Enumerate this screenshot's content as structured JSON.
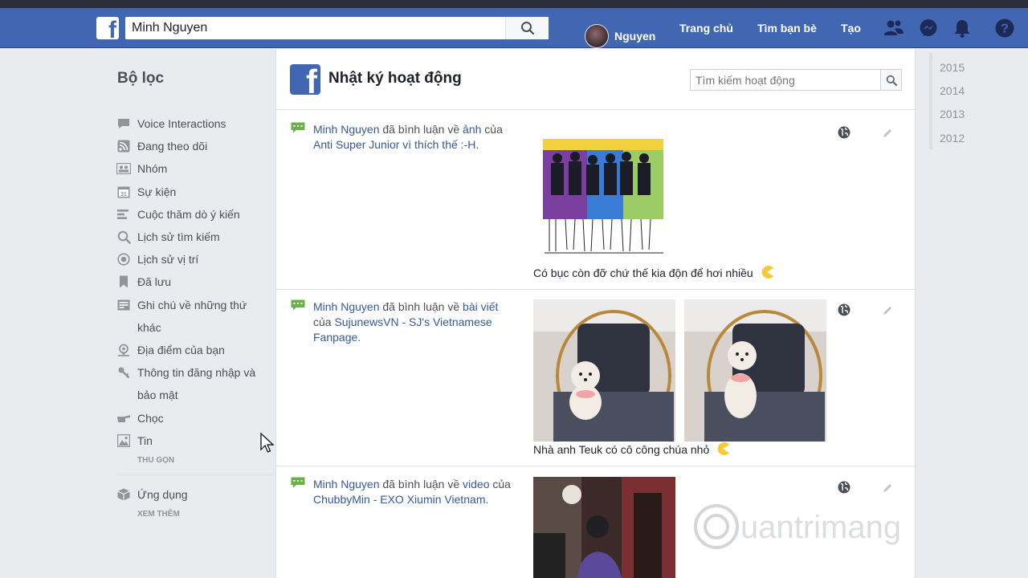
{
  "topbar": {
    "search_value": "Minh Nguyen",
    "user_name": "Nguyen",
    "nav": [
      "Trang chủ",
      "Tìm bạn bè",
      "Tạo"
    ]
  },
  "sidebar": {
    "title": "Bộ lọc",
    "items": [
      {
        "label": "Voice Interactions",
        "icon": "speech-bubble-icon"
      },
      {
        "label": "Đang theo dõi",
        "icon": "rss-icon"
      },
      {
        "label": "Nhóm",
        "icon": "group-icon"
      },
      {
        "label": "Sự kiện",
        "icon": "calendar-icon"
      },
      {
        "label": "Cuộc thăm dò ý kiến",
        "icon": "poll-icon"
      },
      {
        "label": "Lịch sử tìm kiếm",
        "icon": "search-icon"
      },
      {
        "label": "Lịch sử vị trí",
        "icon": "location-target-icon"
      },
      {
        "label": "Đã lưu",
        "icon": "bookmark-icon"
      },
      {
        "label": "Ghi chú về những thứ khác",
        "icon": "note-icon"
      },
      {
        "label": "Địa điểm của bạn",
        "icon": "place-pin-icon"
      },
      {
        "label": "Thông tin đăng nhập và bảo mật",
        "icon": "key-icon"
      },
      {
        "label": "Chọc",
        "icon": "poke-icon"
      },
      {
        "label": "Tin",
        "icon": "photo-icon"
      }
    ],
    "collapse_label": "THU GỌN",
    "apps_label": "Ứng dụng",
    "see_more_label": "XEM THÊM"
  },
  "header": {
    "title": "Nhật ký hoạt động",
    "search_placeholder": "Tìm kiếm hoạt động"
  },
  "entries": [
    {
      "actor": "Minh Nguyen",
      "action": " đã bình luận về ",
      "target": "ảnh",
      "rest": " của ",
      "owner": "Anti Super Junior vì thích thế :-H.",
      "caption": "Có bục còn đỡ chứ thế kia độn để hơi nhiều"
    },
    {
      "actor": "Minh Nguyen",
      "action": " đã bình luận về ",
      "target": "bài viết",
      "rest": " của ",
      "owner": "SujunewsVN - SJ's Vietnamese Fanpage.",
      "caption": "Nhà anh Teuk có cô công chúa nhỏ"
    },
    {
      "actor": "Minh Nguyen",
      "action": " đã bình luận về ",
      "target": "video",
      "rest": " của ",
      "owner": "ChubbyMin - EXO Xiumin Vietnam.",
      "caption": ""
    }
  ],
  "years": [
    "2015",
    "2014",
    "2013",
    "2012"
  ],
  "colors": {
    "brand": "#4267b2",
    "link": "#365899",
    "background": "#e9ebee"
  }
}
